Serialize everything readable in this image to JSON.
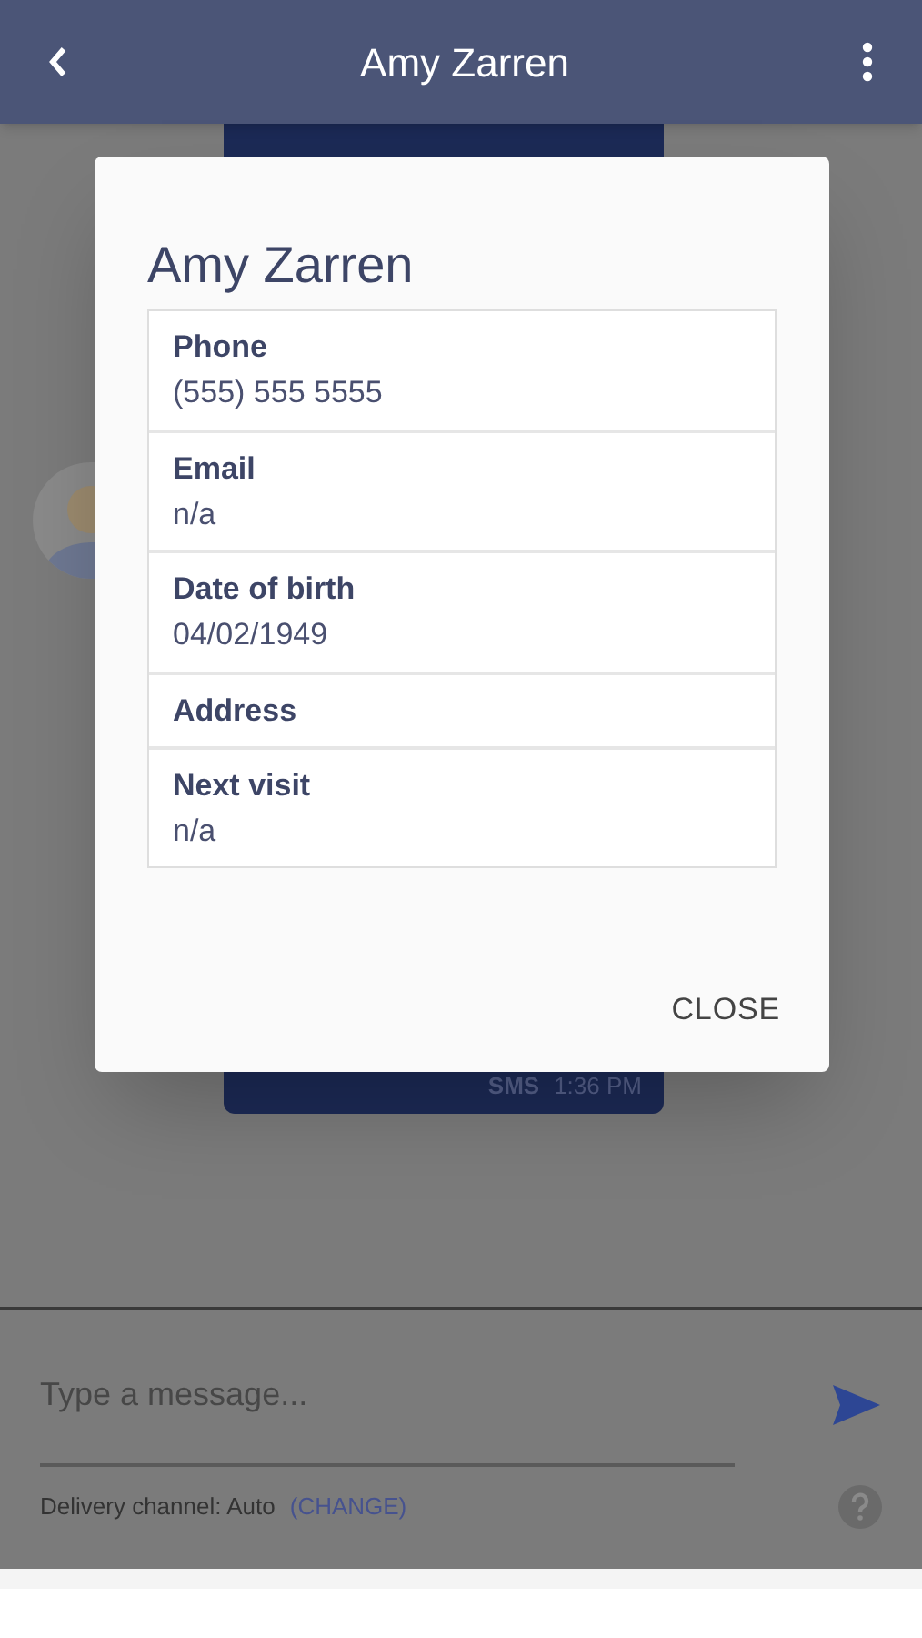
{
  "header": {
    "title": "Amy Zarren"
  },
  "chat": {
    "channel": "SMS",
    "time": "1:36 PM"
  },
  "dialog": {
    "title": "Amy Zarren",
    "fields": [
      {
        "label": "Phone",
        "value": "(555) 555 5555"
      },
      {
        "label": "Email",
        "value": "n/a"
      },
      {
        "label": "Date of birth",
        "value": "04/02/1949"
      },
      {
        "label": "Address"
      },
      {
        "label": "Next visit",
        "value": "n/a"
      }
    ],
    "close": "CLOSE"
  },
  "composer": {
    "placeholder": "Type a message...",
    "delivery": "Delivery channel: Auto",
    "change": "(CHANGE)"
  }
}
